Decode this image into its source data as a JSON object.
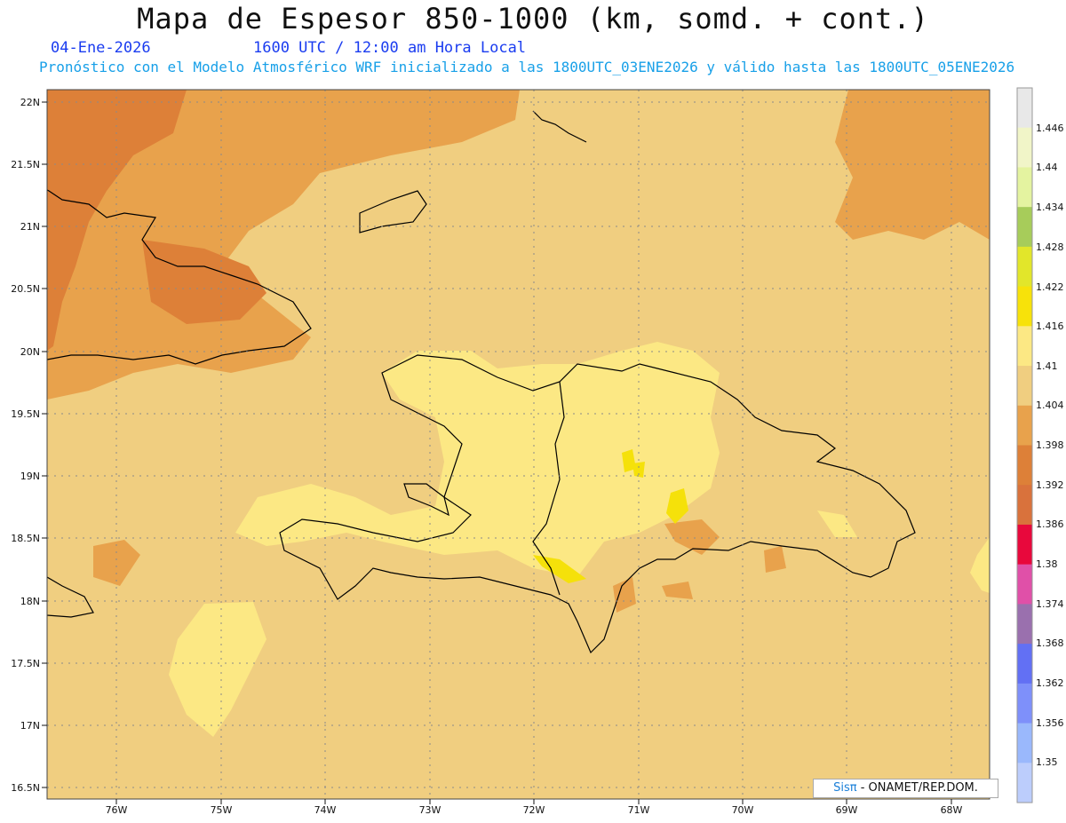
{
  "header": {
    "title": "Mapa de Espesor 850-1000 (km, somd. + cont.)",
    "date": "04-Ene-2026",
    "time": "1600 UTC / 12:00 am Hora Local",
    "subtitle": "Pronóstico con el Modelo Atmosférico WRF inicializado a las 1800UTC_03ENE2026 y válido hasta las  1800UTC_05ENE2026"
  },
  "map": {
    "lat_labels": [
      "22N",
      "21.5N",
      "21N",
      "20.5N",
      "20N",
      "19.5N",
      "19N",
      "18.5N",
      "18N",
      "17.5N",
      "17N",
      "16.5N"
    ],
    "lon_labels": [
      "76W",
      "75W",
      "74W",
      "73W",
      "72W",
      "71W",
      "70W",
      "69W",
      "68W"
    ],
    "colors": {
      "background": "#f0ce80",
      "warm_low": "#e8a24c",
      "warm_lower": "#dd8038",
      "pale": "#fce884",
      "yellow": "#f5e10a",
      "coast": "#000000"
    }
  },
  "colorbar": {
    "levels": [
      "1.446",
      "1.44",
      "1.434",
      "1.428",
      "1.422",
      "1.416",
      "1.41",
      "1.404",
      "1.398",
      "1.392",
      "1.386",
      "1.38",
      "1.374",
      "1.368",
      "1.362",
      "1.356",
      "1.35"
    ],
    "colors": [
      "#e8e8e8",
      "#f1f5c8",
      "#e4f3a0",
      "#a7cc5a",
      "#e2e62a",
      "#f7e20a",
      "#fce884",
      "#f0ce80",
      "#e8a24c",
      "#dd8038",
      "#d9723c",
      "#e8083c",
      "#e050a8",
      "#9a70ae",
      "#6270f4",
      "#7e90fa",
      "#9ab8fc",
      "#bccdfc"
    ]
  },
  "credit": {
    "logo": "Sisπ",
    "text": " - ONAMET/REP.DOM."
  }
}
